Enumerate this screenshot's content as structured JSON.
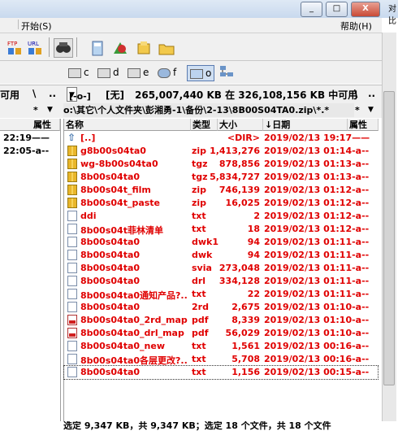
{
  "titlebar": {
    "minimize": "_",
    "maximize": "□",
    "close": "X",
    "right_edge_text": "对比"
  },
  "menu": {
    "item_start": "开始(S)",
    "item_help": "帮助(H)"
  },
  "toolbar": {
    "icons": [
      "ftp-icon",
      "url-icon",
      "find-icon",
      "calculator-icon",
      "compare-icon",
      "pack-icon",
      "folder-icon"
    ]
  },
  "drives": [
    {
      "letter": "c",
      "icon": "hard-drive-icon"
    },
    {
      "letter": "d",
      "icon": "hard-drive-icon"
    },
    {
      "letter": "e",
      "icon": "hard-drive-icon"
    },
    {
      "letter": "f",
      "icon": "network-drive-icon"
    },
    {
      "letter": "o",
      "icon": "computer-icon",
      "active": true
    },
    {
      "letter": "",
      "icon": "network-icon"
    }
  ],
  "infobar": {
    "left_truncated": "可用",
    "left_root": "\\",
    "left_up": "..",
    "drive_select": "[-o-]",
    "volume": "[无]",
    "space_info": "265,007,440 KB 在 326,108,156 KB 中可用",
    "right_root": "\\",
    "right_up": ".."
  },
  "pathbar": {
    "left_filter": "*",
    "path": "o:\\其它\\个人文件夹\\彭湘勇-1\\备份\\2-13\\8B00S04TA0.zip\\*.*",
    "right_filter": "*"
  },
  "left_panel": {
    "header": "属性",
    "rows": [
      {
        "time": "22:19——"
      },
      {
        "time": "22:05-a--"
      }
    ]
  },
  "right_panel": {
    "headers": {
      "name": "名称",
      "type": "类型",
      "size": "大小",
      "date": "↓日期",
      "attr": "属性"
    },
    "rows": [
      {
        "icon": "up-icon",
        "name": "[..]",
        "type": "",
        "size": "<DIR>",
        "date": "2019/02/13 19:17——"
      },
      {
        "icon": "zip-icon",
        "name": "g8b00s04ta0",
        "type": "zip",
        "size": "1,413,276",
        "date": "2019/02/13 01:14-a--"
      },
      {
        "icon": "zip-icon",
        "name": "wg-8b00s04ta0",
        "type": "tgz",
        "size": "878,856",
        "date": "2019/02/13 01:13-a--"
      },
      {
        "icon": "zip-icon",
        "name": "8b00s04ta0",
        "type": "tgz",
        "size": "5,834,727",
        "date": "2019/02/13 01:13-a--"
      },
      {
        "icon": "zip-icon",
        "name": "8b00s04t_film",
        "type": "zip",
        "size": "746,139",
        "date": "2019/02/13 01:12-a--"
      },
      {
        "icon": "zip-icon",
        "name": "8b00s04t_paste",
        "type": "zip",
        "size": "16,025",
        "date": "2019/02/13 01:12-a--"
      },
      {
        "icon": "doc-icon",
        "name": "ddi",
        "type": "txt",
        "size": "2",
        "date": "2019/02/13 01:12-a--"
      },
      {
        "icon": "doc-icon",
        "name": "8b00s04t菲林清单",
        "type": "txt",
        "size": "18",
        "date": "2019/02/13 01:12-a--"
      },
      {
        "icon": "doc-icon",
        "name": "8b00s04ta0",
        "type": "dwk1",
        "size": "94",
        "date": "2019/02/13 01:11-a--"
      },
      {
        "icon": "doc-icon",
        "name": "8b00s04ta0",
        "type": "dwk",
        "size": "94",
        "date": "2019/02/13 01:11-a--"
      },
      {
        "icon": "doc-icon",
        "name": "8b00s04ta0",
        "type": "svia",
        "size": "273,048",
        "date": "2019/02/13 01:11-a--"
      },
      {
        "icon": "doc-icon",
        "name": "8b00s04ta0",
        "type": "drl",
        "size": "334,128",
        "date": "2019/02/13 01:11-a--"
      },
      {
        "icon": "doc-icon",
        "name": "8b00s04ta0通知产品?..",
        "type": "txt",
        "size": "22",
        "date": "2019/02/13 01:11-a--"
      },
      {
        "icon": "doc-icon",
        "name": "8b00s04ta0",
        "type": "2rd",
        "size": "2,675",
        "date": "2019/02/13 01:10-a--"
      },
      {
        "icon": "pdf-icon",
        "name": "8b00s04ta0_2rd_map",
        "type": "pdf",
        "size": "8,339",
        "date": "2019/02/13 01:10-a--"
      },
      {
        "icon": "pdf-icon",
        "name": "8b00s04ta0_drl_map",
        "type": "pdf",
        "size": "56,029",
        "date": "2019/02/13 01:10-a--"
      },
      {
        "icon": "doc-icon",
        "name": "8b00s04ta0_new",
        "type": "txt",
        "size": "1,561",
        "date": "2019/02/13 00:16-a--"
      },
      {
        "icon": "doc-icon",
        "name": "8b00s04ta0各层更改?..",
        "type": "txt",
        "size": "5,708",
        "date": "2019/02/13 00:16-a--"
      },
      {
        "icon": "doc-icon",
        "name": "8b00s04ta0",
        "type": "txt",
        "size": "1,156",
        "date": "2019/02/13 00:15-a--",
        "focused": true
      }
    ]
  },
  "status": "选定 9,347 KB，共 9,347 KB；选定 18 个文件，共 18 个文件"
}
